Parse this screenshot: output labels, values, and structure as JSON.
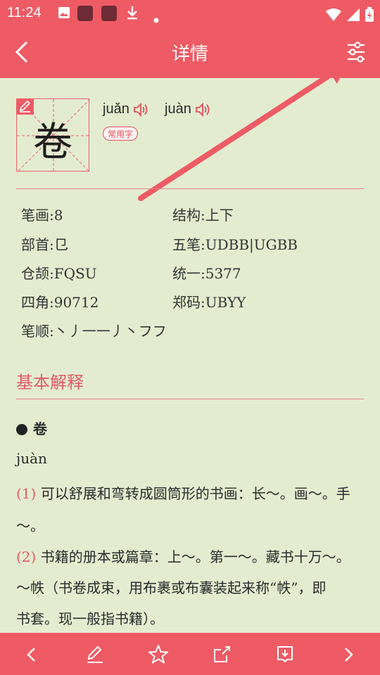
{
  "status_bar": {
    "time": "11:24",
    "icons": [
      "image-icon",
      "app-icon",
      "app-icon",
      "download-icon",
      "dot-icon",
      "wifi-icon",
      "signal-icon",
      "battery-icon"
    ]
  },
  "app_bar": {
    "title": "详情",
    "back_icon": "chevron-left-icon",
    "settings_icon": "sliders-icon"
  },
  "character": {
    "glyph": "卷",
    "pinyin": [
      "juǎn",
      "juàn"
    ],
    "badge": "常用字"
  },
  "info": {
    "strokes": "笔画:8",
    "structure": "结构:上下",
    "radical": "部首:㔾",
    "wubi": "五笔:UDBB|UGBB",
    "cangjie": "仓颉:FQSU",
    "unicode": "统一:5377",
    "four_corner": "四角:90712",
    "zhengma": "郑码:UBYY",
    "stroke_order": "笔顺:丶丿一一丿丶フフ"
  },
  "basic": {
    "section_title": "基本解释",
    "entry_char": "卷",
    "entry_pinyin": "juàn",
    "definitions": [
      {
        "num": "(1)",
        "text_line1": "可以舒展和弯转成圆筒形的书画：长～。画～。手",
        "text_line2": "～。"
      },
      {
        "num": "(2)",
        "text_line1": "书籍的册本或篇章：上～。第一～。藏书十万～。",
        "text_line2": "～帙（书卷成束，用布裹或布囊装起来称“帙”，即",
        "text_line3": "书套。现一般指书籍）。"
      }
    ]
  },
  "bottom_bar": {
    "buttons": [
      "chevron-left-icon",
      "pencil-icon",
      "star-icon",
      "share-icon",
      "bookmark-icon",
      "chevron-right-icon"
    ]
  },
  "colors": {
    "accent": "#ee5b65",
    "background": "#e4ecd0",
    "text": "#2a2a2a"
  }
}
